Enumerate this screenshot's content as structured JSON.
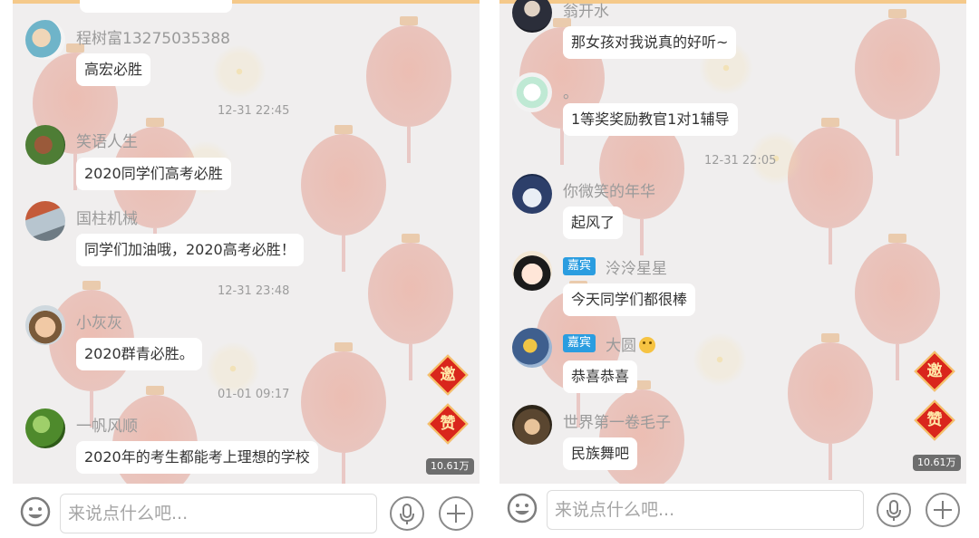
{
  "left": {
    "messages": [
      {
        "name": "",
        "text": ""
      },
      {
        "name": "程树富13275035388",
        "text": "高宏必胜"
      },
      {
        "time": "12-31 22:45"
      },
      {
        "name": "笑语人生",
        "text": "2020同学们高考必胜"
      },
      {
        "name": "国柱机械",
        "text": "同学们加油哦，2020高考必胜！"
      },
      {
        "time": "12-31 23:48"
      },
      {
        "name": "小灰灰",
        "text": "2020群青必胜。"
      },
      {
        "time": "01-01 09:17"
      },
      {
        "name": "一帆风顺",
        "text": "2020年的考生都能考上理想的学校"
      }
    ],
    "invite_label": "邀",
    "like_label": "赞",
    "view_count": "10.61万",
    "input_placeholder": "来说点什么吧..."
  },
  "right": {
    "messages": [
      {
        "name": "翁开水",
        "text": "那女孩对我说真的好听~"
      },
      {
        "name": "。",
        "text": "1等奖奖励教官1对1辅导"
      },
      {
        "time": "12-31 22:05"
      },
      {
        "name": "你微笑的年华",
        "text": "起风了"
      },
      {
        "badge": "嘉宾",
        "name": "泠泠星星",
        "text": "今天同学们都很棒"
      },
      {
        "badge": "嘉宾",
        "name": "大圆",
        "text": "恭喜恭喜"
      },
      {
        "name": "世界第一卷毛子",
        "text": "民族舞吧"
      }
    ],
    "invite_label": "邀",
    "like_label": "赞",
    "view_count": "10.61万",
    "input_placeholder": "来说点什么吧..."
  },
  "icons": {
    "emoji": "smiley-icon",
    "voice": "microphone-icon",
    "add": "plus-icon",
    "thinking_emoji": "thinking-face-emoji"
  },
  "colors": {
    "guest_badge": "#2b9de0",
    "invite_diamond": "#d9261c",
    "chat_background": "#f0eeee"
  }
}
